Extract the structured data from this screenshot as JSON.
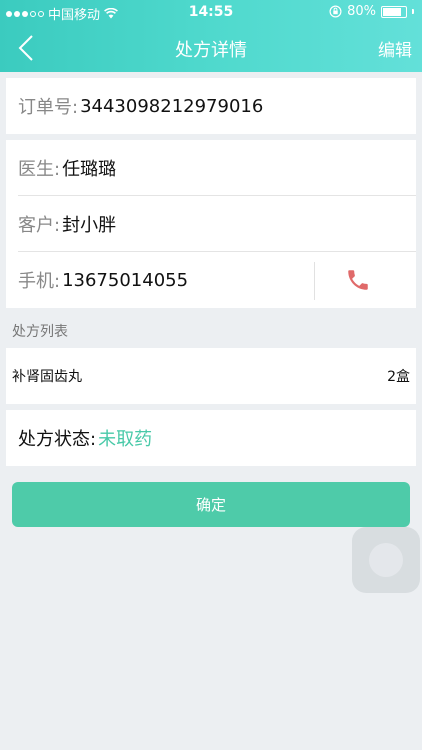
{
  "status_bar": {
    "carrier": "中国移动",
    "time": "14:55",
    "battery": "80%",
    "battery_level": 0.8,
    "icons": [
      "signal-dots",
      "wifi-icon",
      "rotation-lock-icon",
      "battery-icon"
    ]
  },
  "nav": {
    "title": "处方详情",
    "edit": "编辑",
    "back_icon": "chevron-left-icon"
  },
  "order": {
    "label": "订单号:",
    "value": "3443098212979016"
  },
  "info": {
    "doctor_label": "医生:",
    "doctor": "任璐璐",
    "customer_label": "客户:",
    "customer": "封小胖",
    "phone_label": "手机:",
    "phone": "13675014055",
    "phone_icon": "phone-icon"
  },
  "prescription_list": {
    "title": "处方列表",
    "items": [
      {
        "name": "补肾固齿丸",
        "qty": "2盒"
      }
    ]
  },
  "status": {
    "label": "处方状态:",
    "value": "未取药",
    "color": "#48c9a8"
  },
  "confirm_label": "确定",
  "colors": {
    "header_start": "#3bcbbf",
    "header_end": "#63e0d9",
    "accent": "#4ecba9",
    "phone_icon": "#e06a6a",
    "background": "#eceff2"
  }
}
